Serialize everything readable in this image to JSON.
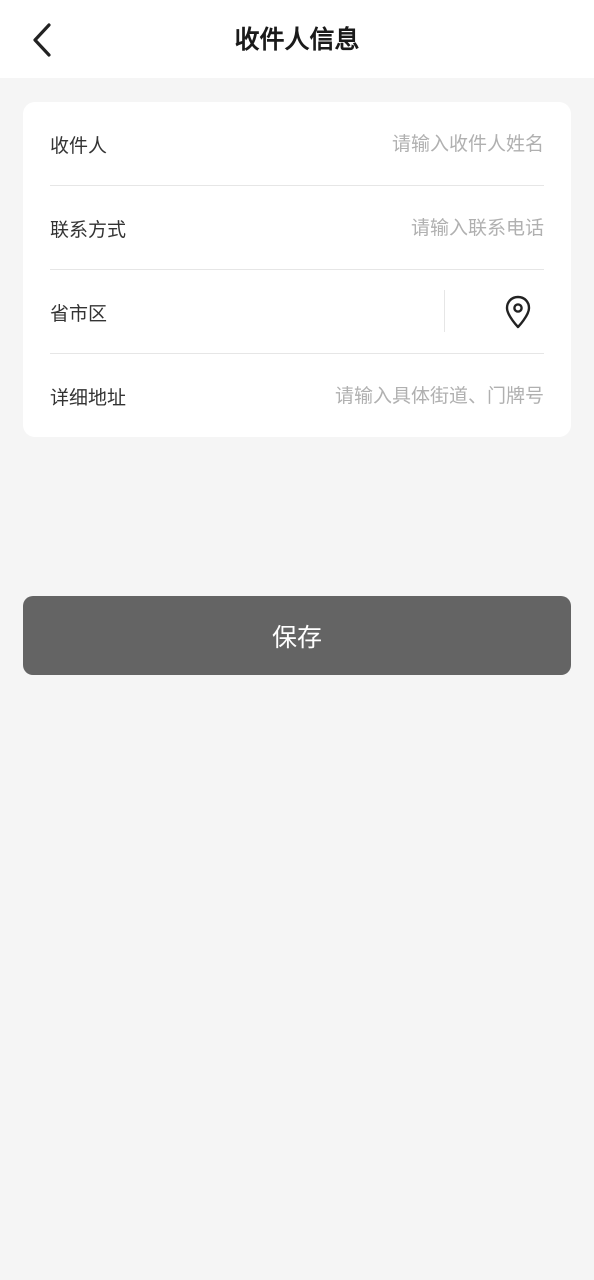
{
  "header": {
    "title": "收件人信息",
    "back_icon": "chevron-left-icon"
  },
  "form": {
    "recipient": {
      "label": "收件人",
      "value": "",
      "placeholder": "请输入收件人姓名"
    },
    "phone": {
      "label": "联系方式",
      "value": "",
      "placeholder": "请输入联系电话"
    },
    "region": {
      "label": "省市区",
      "value": "",
      "location_icon": "location-pin-icon"
    },
    "address": {
      "label": "详细地址",
      "value": "",
      "placeholder": "请输入具体街道、门牌号"
    }
  },
  "save_button": {
    "label": "保存"
  },
  "colors": {
    "background": "#f5f5f5",
    "card": "#ffffff",
    "button": "#646464",
    "placeholder": "#b0b0b0"
  }
}
